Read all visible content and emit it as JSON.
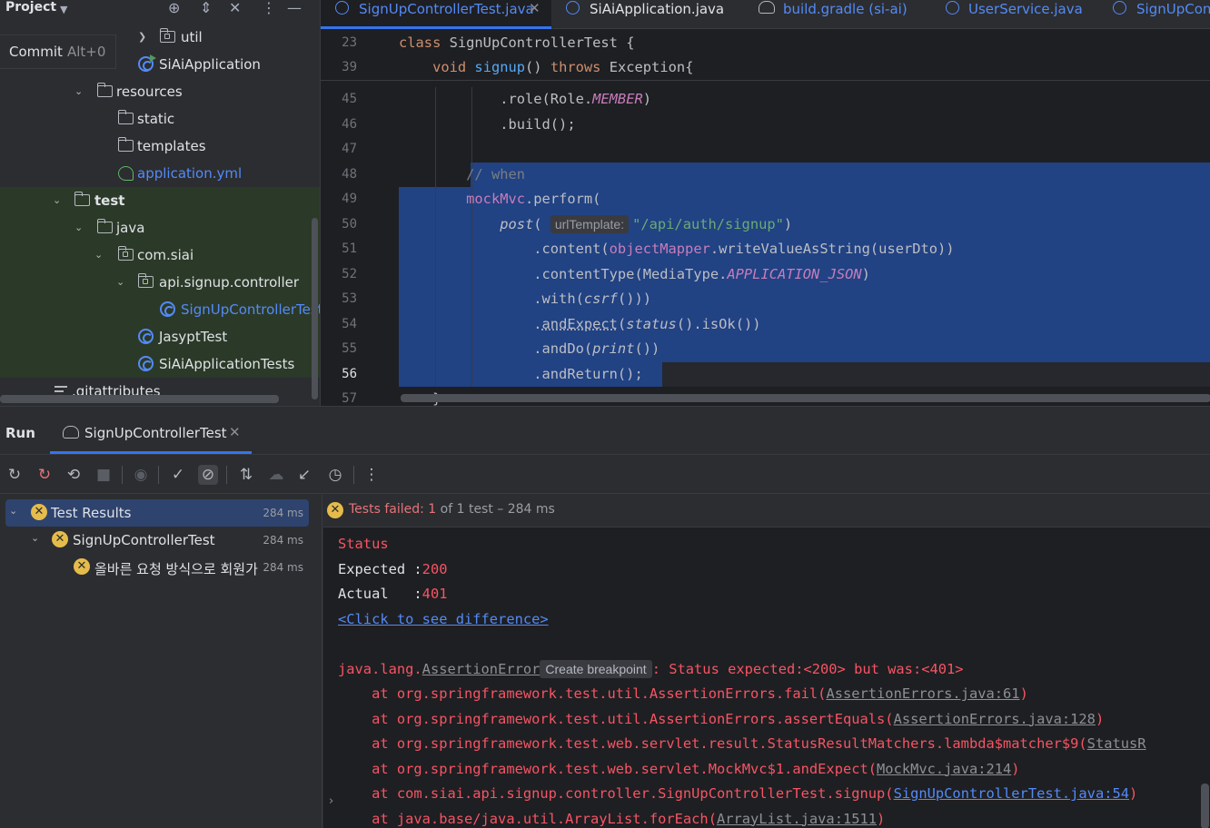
{
  "project": {
    "title": "Project",
    "commit_label": "Commit",
    "commit_shortcut": "Alt+0",
    "tree": [
      {
        "label": "util",
        "kind": "folder-pkg"
      },
      {
        "label": "SiAiApplication",
        "kind": "class-run"
      },
      {
        "label": "resources",
        "kind": "folder-res"
      },
      {
        "label": "static",
        "kind": "folder"
      },
      {
        "label": "templates",
        "kind": "folder"
      },
      {
        "label": "application.yml",
        "kind": "yml"
      },
      {
        "label": "test",
        "kind": "folder-test"
      },
      {
        "label": "java",
        "kind": "folder"
      },
      {
        "label": "com.siai",
        "kind": "folder-pkg"
      },
      {
        "label": "api.signup.controller",
        "kind": "folder-pkg"
      },
      {
        "label": "SignUpControllerTest",
        "kind": "class"
      },
      {
        "label": "JasyptTest",
        "kind": "class"
      },
      {
        "label": "SiAiApplicationTests",
        "kind": "class"
      },
      {
        "label": ".gitattributes",
        "kind": "text"
      }
    ]
  },
  "editor": {
    "tabs": [
      {
        "label": "SignUpControllerTest.java",
        "active": true
      },
      {
        "label": "SiAiApplication.java",
        "active": false
      },
      {
        "label": "build.gradle (si-ai)",
        "active": false
      },
      {
        "label": "UserService.java",
        "active": false
      },
      {
        "label": "SignUpCont",
        "active": false
      }
    ],
    "sticky": [
      {
        "num": "23",
        "parts": [
          [
            "k",
            "class "
          ],
          [
            "",
            "SignUpControllerTest {"
          ]
        ]
      },
      {
        "num": "39",
        "parts": [
          [
            "",
            "    "
          ],
          [
            "k",
            "void "
          ],
          [
            "fn",
            "signup"
          ],
          [
            "",
            "() "
          ],
          [
            "k",
            "throws "
          ],
          [
            "",
            "Exception{"
          ]
        ]
      }
    ],
    "lines": [
      {
        "num": "45",
        "parts": [
          [
            "",
            "            .role(Role."
          ],
          [
            "sfi",
            "MEMBER"
          ],
          [
            "",
            ")"
          ]
        ]
      },
      {
        "num": "46",
        "parts": [
          [
            "",
            "            .build();"
          ]
        ]
      },
      {
        "num": "47",
        "parts": []
      },
      {
        "num": "48",
        "parts": [
          [
            "",
            "        "
          ],
          [
            "cmt",
            "// when"
          ]
        ]
      },
      {
        "num": "49",
        "parts": [
          [
            "",
            "        "
          ],
          [
            "fld",
            "mockMvc"
          ],
          [
            "",
            ".perform("
          ]
        ]
      },
      {
        "num": "50",
        "parts": [
          [
            "",
            "            "
          ],
          [
            "it",
            "post"
          ],
          [
            "",
            "( "
          ],
          [
            "hint",
            "urlTemplate:"
          ],
          [
            "str",
            "\"/api/auth/signup\""
          ],
          [
            "",
            ")"
          ]
        ]
      },
      {
        "num": "51",
        "parts": [
          [
            "",
            "                .content("
          ],
          [
            "fld",
            "objectMapper"
          ],
          [
            "",
            ".writeValueAsString(userDto))"
          ]
        ]
      },
      {
        "num": "52",
        "parts": [
          [
            "",
            "                .contentType(MediaType."
          ],
          [
            "sfi",
            "APPLICATION_JSON"
          ],
          [
            "",
            ")"
          ]
        ]
      },
      {
        "num": "53",
        "parts": [
          [
            "",
            "                .with("
          ],
          [
            "it",
            "csrf"
          ],
          [
            "",
            "()))"
          ]
        ]
      },
      {
        "num": "54",
        "parts": [
          [
            "",
            "                ."
          ],
          [
            "ul",
            "andExpect"
          ],
          [
            "",
            "("
          ],
          [
            "it",
            "status"
          ],
          [
            "",
            "().isOk())"
          ]
        ]
      },
      {
        "num": "55",
        "parts": [
          [
            "",
            "                .andDo("
          ],
          [
            "it",
            "print"
          ],
          [
            "",
            "())"
          ]
        ]
      },
      {
        "num": "56",
        "parts": [
          [
            "",
            "                .andReturn();"
          ]
        ]
      },
      {
        "num": "57",
        "parts": [
          [
            "",
            "    }"
          ]
        ]
      }
    ]
  },
  "run": {
    "title": "Run",
    "tab_label": "SignUpControllerTest",
    "results": [
      {
        "label": "Test Results",
        "time": "284 ms"
      },
      {
        "label": "SignUpControllerTest",
        "time": "284 ms"
      },
      {
        "label": "올바른 요청 방식으로 회원가",
        "time": "284 ms"
      }
    ],
    "summary": {
      "prefix": "Tests failed: ",
      "failed": "1",
      "suffix": " of 1 test – 284 ms"
    },
    "console": {
      "status": "Status",
      "expected_label": "Expected :",
      "expected_value": "200",
      "actual_label": "Actual   :",
      "actual_value": "401",
      "diff_link": "<Click to see difference>",
      "error_class": "java.lang.",
      "error_type": "AssertionError",
      "breakpoint_hint": "Create breakpoint",
      "error_message": ": Status expected:<200> but was:<401>",
      "stack": [
        {
          "text": "    at org.springframework.test.util.AssertionErrors.fail(",
          "link": "AssertionErrors.java:61",
          "end": ")",
          "user": false
        },
        {
          "text": "    at org.springframework.test.util.AssertionErrors.assertEquals(",
          "link": "AssertionErrors.java:128",
          "end": ")",
          "user": false
        },
        {
          "text": "    at org.springframework.test.web.servlet.result.StatusResultMatchers.lambda$matcher$9(",
          "link": "StatusR",
          "end": "",
          "user": false
        },
        {
          "text": "    at org.springframework.test.web.servlet.MockMvc$1.andExpect(",
          "link": "MockMvc.java:214",
          "end": ")",
          "user": false
        },
        {
          "text": "    at com.siai.api.signup.controller.SignUpControllerTest.signup(",
          "link": "SignUpControllerTest.java:54",
          "end": ")",
          "user": true
        },
        {
          "text": "    at java.base/java.util.ArrayList.forEach(",
          "link": "ArrayList.java:1511",
          "end": ")",
          "user": false
        }
      ]
    }
  },
  "colors": {
    "accent": "#3574f0",
    "selection": "#214283",
    "error": "#f75464",
    "warning_badge": "#e5bc4b"
  }
}
